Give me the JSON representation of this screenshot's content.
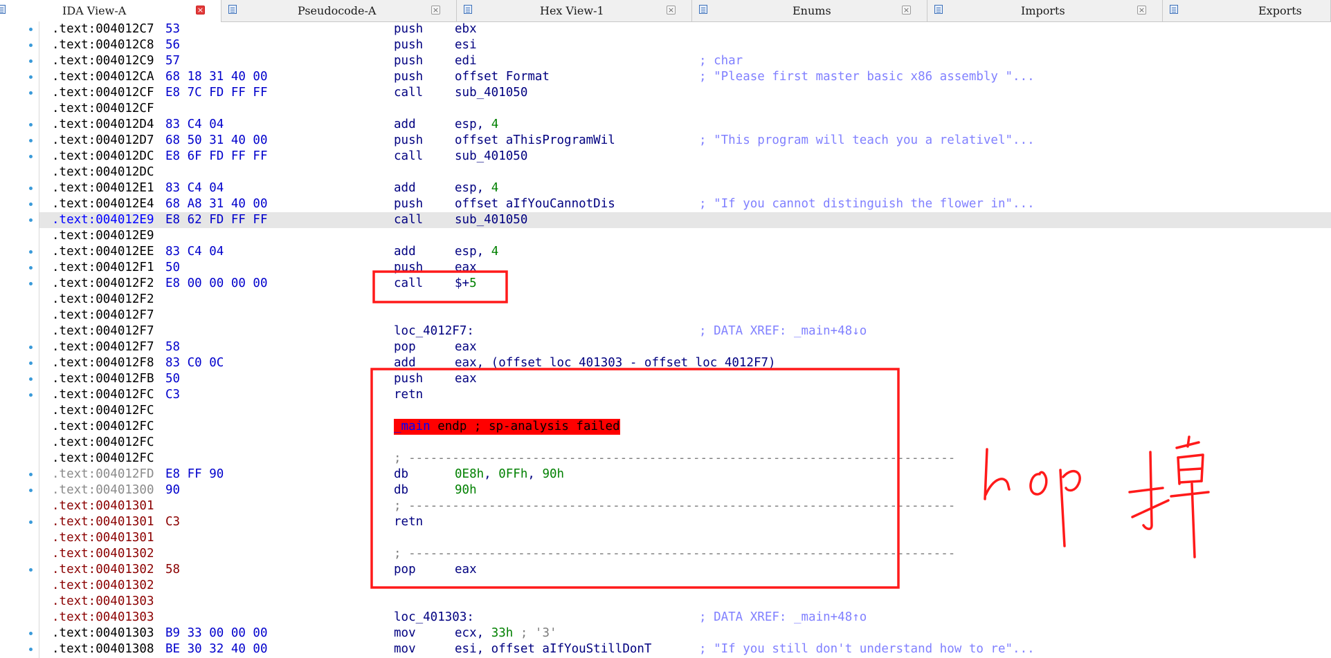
{
  "tabs": [
    {
      "label": "IDA View-A",
      "close": "×"
    },
    {
      "label": "Pseudocode-A",
      "close": "×"
    },
    {
      "label": "Hex View-1",
      "close": "×"
    },
    {
      "label": "Enums",
      "close": "×"
    },
    {
      "label": "Imports",
      "close": "×"
    },
    {
      "label": "Exports"
    }
  ],
  "listing": [
    {
      "addr": ".text:004012C7",
      "bytes": "53",
      "mnem": "push",
      "ops": "ebx"
    },
    {
      "addr": ".text:004012C8",
      "bytes": "56",
      "mnem": "push",
      "ops": "esi"
    },
    {
      "addr": ".text:004012C9",
      "bytes": "57",
      "mnem": "push",
      "ops": "edi",
      "cmt": "; char"
    },
    {
      "addr": ".text:004012CA",
      "bytes": "68 18 31 40 00",
      "mnem": "push",
      "ops": "offset Format",
      "cmt": "; \"Please first master basic x86 assembly \"..."
    },
    {
      "addr": ".text:004012CF",
      "bytes": "E8 7C FD FF FF",
      "mnem": "call",
      "ops": "sub_401050"
    },
    {
      "addr": ".text:004012CF"
    },
    {
      "addr": ".text:004012D4",
      "bytes": "83 C4 04",
      "mnem": "add",
      "ops": "esp, ",
      "num": "4"
    },
    {
      "addr": ".text:004012D7",
      "bytes": "68 50 31 40 00",
      "mnem": "push",
      "ops": "offset aThisProgramWil",
      "cmt": "; \"This program will teach you a relativel\"..."
    },
    {
      "addr": ".text:004012DC",
      "bytes": "E8 6F FD FF FF",
      "mnem": "call",
      "ops": "sub_401050"
    },
    {
      "addr": ".text:004012DC"
    },
    {
      "addr": ".text:004012E1",
      "bytes": "83 C4 04",
      "mnem": "add",
      "ops": "esp, ",
      "num": "4"
    },
    {
      "addr": ".text:004012E4",
      "bytes": "68 A8 31 40 00",
      "mnem": "push",
      "ops": "offset aIfYouCannotDis",
      "cmt": "; \"If you cannot distinguish the flower in\"..."
    },
    {
      "addr": ".text:004012E9",
      "bytes": "E8 62 FD FF FF",
      "mnem": "call",
      "ops": "sub_401050"
    },
    {
      "addr": ".text:004012E9"
    },
    {
      "addr": ".text:004012EE",
      "bytes": "83 C4 04",
      "mnem": "add",
      "ops": "esp, ",
      "num": "4"
    },
    {
      "addr": ".text:004012F1",
      "bytes": "50",
      "mnem": "push",
      "ops": "eax"
    },
    {
      "addr": ".text:004012F2",
      "bytes": "E8 00 00 00 00",
      "mnem": "call",
      "ops": "$+",
      "num": "5"
    },
    {
      "addr": ".text:004012F2"
    },
    {
      "addr": ".text:004012F7"
    },
    {
      "addr": ".text:004012F7",
      "mnem": "loc_4012F7:",
      "cmt": "; DATA XREF: _main+48↓o"
    },
    {
      "addr": ".text:004012F7",
      "bytes": "58",
      "mnem": "pop",
      "ops": "eax"
    },
    {
      "addr": ".text:004012F8",
      "bytes": "83 C0 0C",
      "mnem": "add",
      "ops": "eax, (offset loc_401303 - offset loc_4012F7)"
    },
    {
      "addr": ".text:004012FB",
      "bytes": "50",
      "mnem": "push",
      "ops": "eax"
    },
    {
      "addr": ".text:004012FC",
      "bytes": "C3",
      "mnem": "retn"
    },
    {
      "addr": ".text:004012FC"
    },
    {
      "addr": ".text:004012FC",
      "endp_fn": "_main",
      "endp_rest": " endp ; sp-analysis failed"
    },
    {
      "addr": ".text:004012FC"
    },
    {
      "addr": ".text:004012FC",
      "dashes": "; ---------------------------------------------------------------------------"
    },
    {
      "addr": ".text:004012FD",
      "bytes": "E8 FF 90",
      "mnem": "db",
      "db": [
        [
          "0E8h",
          ", "
        ],
        [
          "0FFh",
          ", "
        ],
        [
          "90h",
          ""
        ]
      ]
    },
    {
      "addr": ".text:00401300",
      "bytes": "90",
      "mnem": "db",
      "db": [
        [
          "90h",
          ""
        ]
      ]
    },
    {
      "addr": ".text:00401301",
      "dashes": "; ---------------------------------------------------------------------------"
    },
    {
      "addr": ".text:00401301",
      "bytes": "C3",
      "mnem": "retn"
    },
    {
      "addr": ".text:00401301"
    },
    {
      "addr": ".text:00401302",
      "dashes": "; ---------------------------------------------------------------------------"
    },
    {
      "addr": ".text:00401302",
      "bytes": "58",
      "mnem": "pop",
      "ops": "eax"
    },
    {
      "addr": ".text:00401302"
    },
    {
      "addr": ".text:00401303"
    },
    {
      "addr": ".text:00401303",
      "mnem": "loc_401303:",
      "cmt": "; DATA XREF: _main+48↑o"
    },
    {
      "addr": ".text:00401303",
      "bytes": "B9 33 00 00 00",
      "mnem": "mov",
      "ops": "ecx, ",
      "num": "33h",
      "str": " ; '3'"
    },
    {
      "addr": ".text:00401308",
      "bytes": "BE 30 32 40 00",
      "mnem": "mov",
      "ops": "esi, offset aIfYouStillDonT",
      "cmt": "; \"If you still don't understand how to re\"..."
    }
  ]
}
